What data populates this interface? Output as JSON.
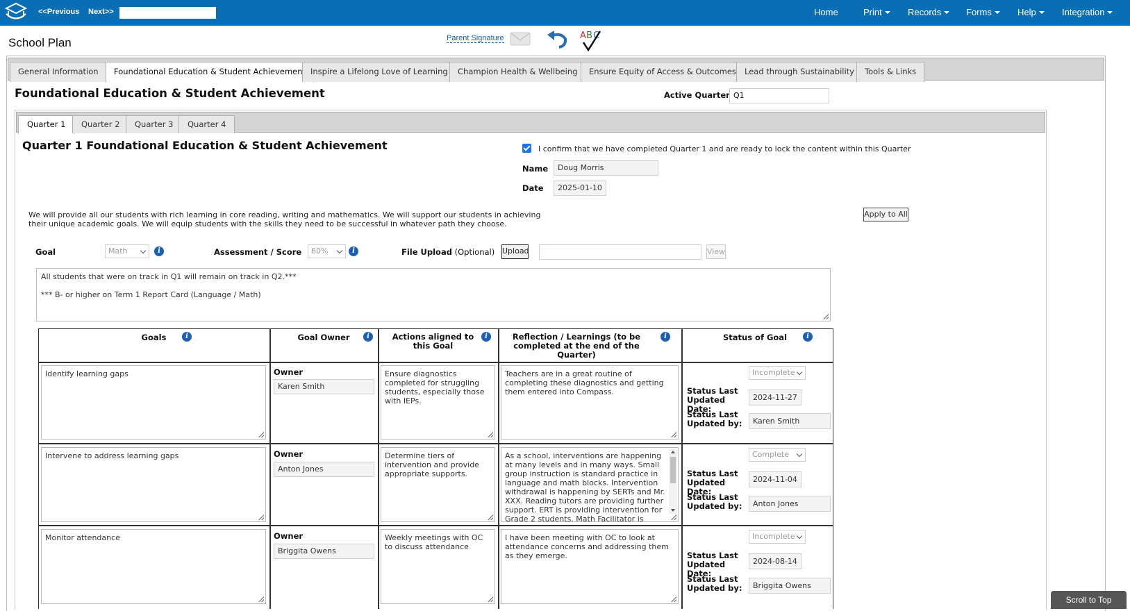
{
  "topbar": {
    "prev_label": "<<Previous",
    "next_label": "Next>>",
    "search_value": "",
    "menus": [
      "Home",
      "Print",
      "Records",
      "Forms",
      "Help",
      "Integration"
    ],
    "bg_color": "#0a6eb5"
  },
  "page": {
    "title": "School Plan",
    "parent_signature": "Parent Signature",
    "icons": [
      "envelope-icon",
      "undo-icon",
      "spellcheck-icon"
    ]
  },
  "main_tabs": [
    "General Information",
    "Foundational Education & Student Achievement",
    "Inspire a Lifelong Love of Learning",
    "Champion Health & Wellbeing",
    "Ensure Equity of Access & Outcomes",
    "Lead through Sustainability",
    "Tools & Links"
  ],
  "section": {
    "title": "Foundational Education & Student Achievement",
    "active_quarter_label": "Active Quarter",
    "active_quarter_value": "Q1"
  },
  "quarter_tabs": [
    "Quarter 1",
    "Quarter 2",
    "Quarter 3",
    "Quarter 4"
  ],
  "quarter": {
    "title": "Quarter 1 Foundational Education & Student Achievement",
    "confirm_checked": true,
    "confirm_text": "I confirm that we have completed Quarter 1 and are ready to lock the content within this Quarter",
    "name_label": "Name",
    "name_value": "Doug Morris",
    "date_label": "Date",
    "date_value": "2025-01-10",
    "description": "We will provide all our students with rich learning in core reading, writing and mathematics. We will support our students in achieving their unique academic goals. We will equip students with the skills they need to be successful in whatever path they choose.",
    "apply_label": "Apply to All",
    "goal_label": "Goal",
    "goal_value": "Math",
    "assessment_label": "Assessment / Score",
    "assessment_value": "60%",
    "file_upload_label": "File Upload",
    "file_upload_optional": "(Optional)",
    "upload_button": "Upload",
    "file_value": "",
    "view_button": "View",
    "goal_text_line1": "All students that were on track in Q1 will remain on track in Q2.***",
    "goal_text_line2": "*** B- or higher on Term 1 Report Card (Language / Math)"
  },
  "table": {
    "headers": {
      "goals": "Goals",
      "owner": "Goal Owner",
      "actions": "Actions aligned to this Goal",
      "reflection": "Reflection / Learnings (to be completed at the end of the Quarter)",
      "status": "Status of Goal"
    },
    "owner_label": "Owner",
    "status_date_label": "Status Last Updated Date:",
    "status_by_label": "Status Last Updated by:",
    "rows": [
      {
        "goal": "Identify learning gaps",
        "owner": "Karen Smith",
        "actions": "Ensure diagnostics completed for struggling students, especially those with IEPs.",
        "reflection": "Teachers are in a great routine of completing these diagnostics and getting them entered into Compass.",
        "status": "Incomplete",
        "updated_date": "2024-11-27",
        "updated_by": "Karen Smith"
      },
      {
        "goal": "Intervene to address learning gaps",
        "owner": "Anton Jones",
        "actions": "Determine tiers of intervention and provide appropriate supports.",
        "reflection": "As a school, interventions are happening at many levels and in many ways. Small group instruction is standard practice in language and math blocks. Intervention withdrawal is happening by SERTs and Mr. XXX. Reading tutors are providing further support. ERT is providing intervention for Grade 2 students. Math Facilitator is",
        "status": "Complete",
        "updated_date": "2024-11-04",
        "updated_by": "Anton Jones"
      },
      {
        "goal": "Monitor attendance",
        "owner": "Briggita Owens",
        "actions": "Weekly meetings with OC to discuss attendance",
        "reflection": "I have been meeting with OC to look at attendance concerns and addressing them as they emerge.",
        "status": "Incomplete",
        "updated_date": "2024-08-14",
        "updated_by": "Briggita Owens"
      }
    ]
  },
  "scroll_to_top": "Scroll to Top"
}
